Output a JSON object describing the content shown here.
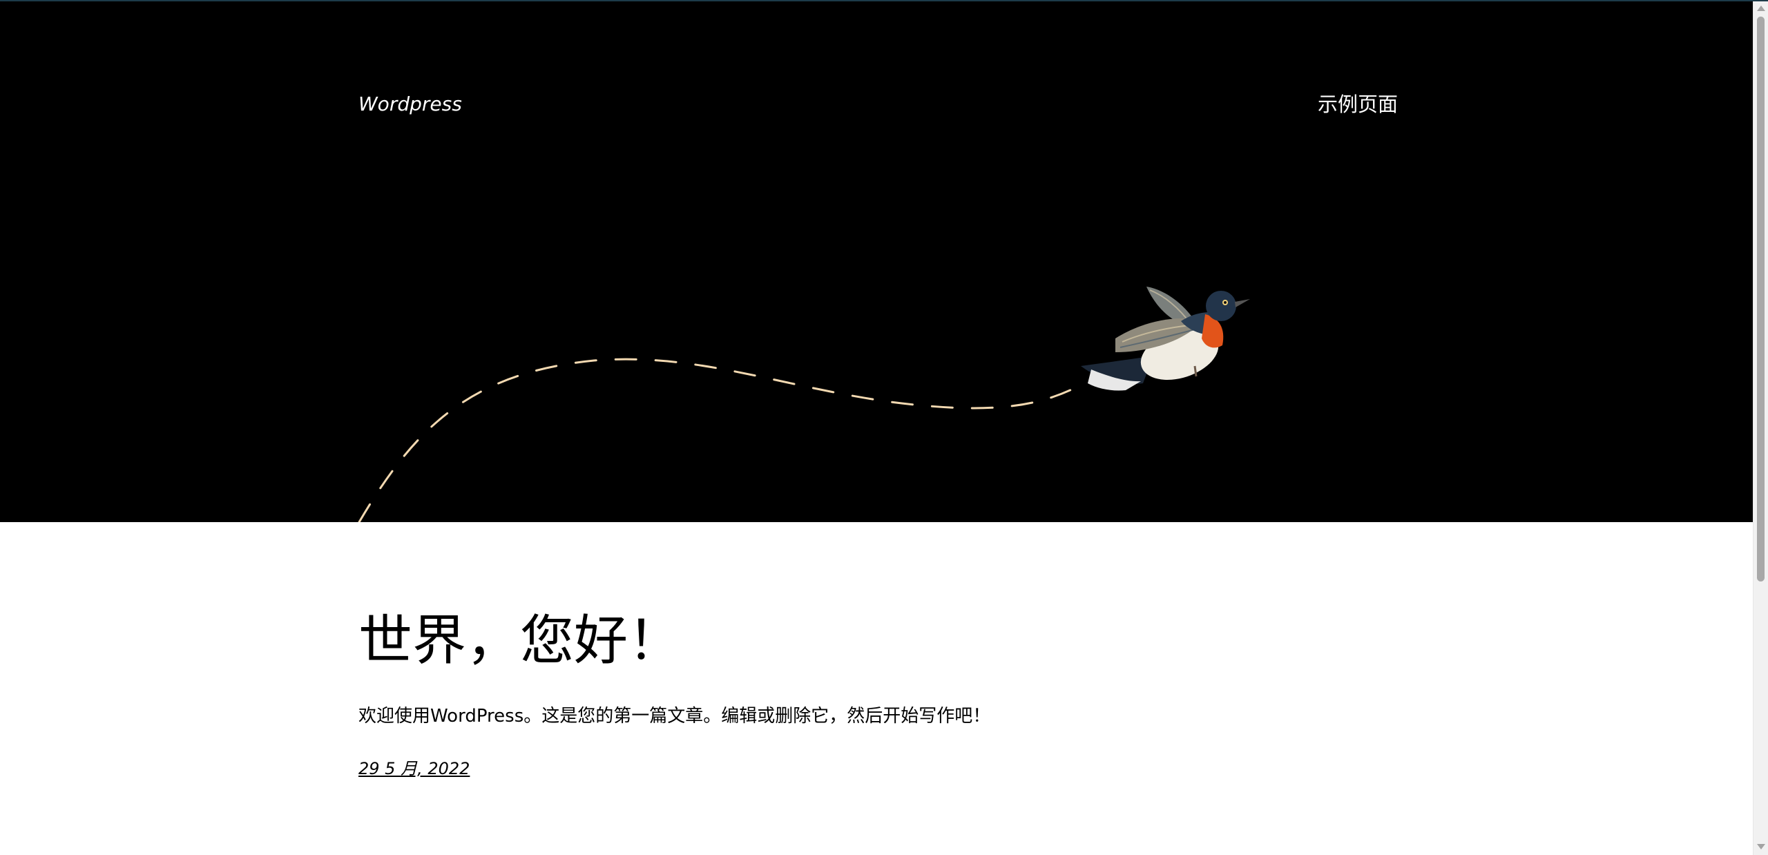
{
  "header": {
    "site_title": "Wordpress",
    "nav_items": [
      {
        "label": "示例页面"
      }
    ]
  },
  "hero": {
    "image": "bird-illustration",
    "path_color": "#f3d9b1",
    "background": "#000000"
  },
  "post": {
    "title": "世界，您好！",
    "excerpt": "欢迎使用WordPress。这是您的第一篇文章。编辑或删除它，然后开始写作吧！",
    "date": "29 5 月, 2022"
  },
  "icons": {
    "scroll_up": "chevron-up-icon",
    "scroll_down": "chevron-down-icon"
  }
}
